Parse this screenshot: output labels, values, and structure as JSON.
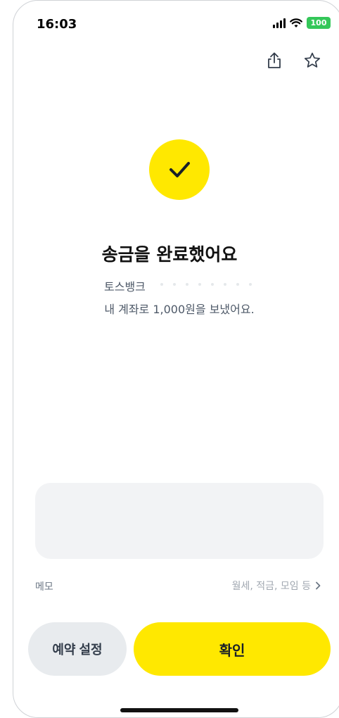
{
  "status_bar": {
    "time": "16:03",
    "battery": "100",
    "battery_color": "#34c759"
  },
  "header": {
    "icons": [
      "share-icon",
      "star-icon"
    ]
  },
  "result": {
    "icon": "check-icon",
    "accent": "#ffe800",
    "title": "송금을 완료했어요",
    "bank_name": "토스뱅크",
    "message": "내 계좌로 1,000원을 보냈어요."
  },
  "memo": {
    "label": "메모",
    "hint": "월세, 적금, 모임 등",
    "chevron": "chevron-right-icon"
  },
  "buttons": {
    "secondary_label": "예약 설정",
    "primary_label": "확인"
  }
}
